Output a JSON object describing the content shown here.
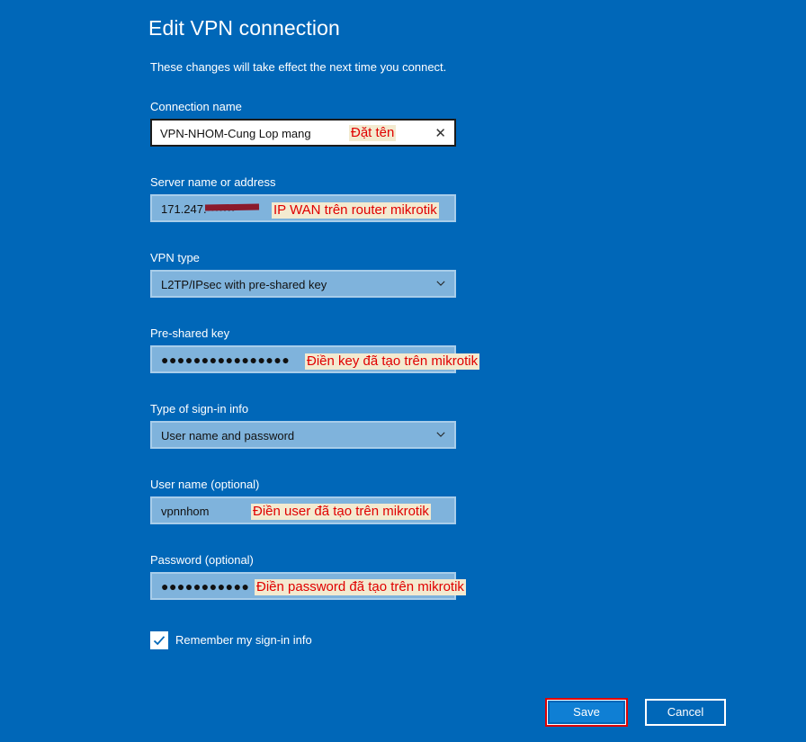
{
  "dialog": {
    "title": "Edit VPN connection",
    "subtitle": "These changes will take effect the next time you connect."
  },
  "fields": {
    "connection_name": {
      "label": "Connection name",
      "value": "VPN-NHOM-Cung Lop mang"
    },
    "server": {
      "label": "Server name or address",
      "value": "171.247.•••••••"
    },
    "vpn_type": {
      "label": "VPN type",
      "value": "L2TP/IPsec with pre-shared key"
    },
    "psk": {
      "label": "Pre-shared key",
      "value": "●●●●●●●●●●●●●●●●"
    },
    "signin_type": {
      "label": "Type of sign-in info",
      "value": "User name and password"
    },
    "username": {
      "label": "User name (optional)",
      "value": "vpnnhom"
    },
    "password": {
      "label": "Password (optional)",
      "value": "●●●●●●●●●●●"
    }
  },
  "remember": {
    "label": "Remember my sign-in info",
    "checked": true
  },
  "buttons": {
    "save": "Save",
    "cancel": "Cancel"
  },
  "annotations": {
    "name": "Đặt tên",
    "server": "IP WAN trên router mikrotik",
    "psk": "Điền key đã tạo trên mikrotik",
    "user": "Điền user đã tạo trên mikrotik",
    "password": "Điền password đã tạo trên mikrotik"
  },
  "icons": {
    "clear": "close-icon",
    "dropdown": "chevron-down-icon",
    "check": "checkmark-icon"
  },
  "colors": {
    "background": "#0067b8",
    "annotation": "#e00000"
  }
}
